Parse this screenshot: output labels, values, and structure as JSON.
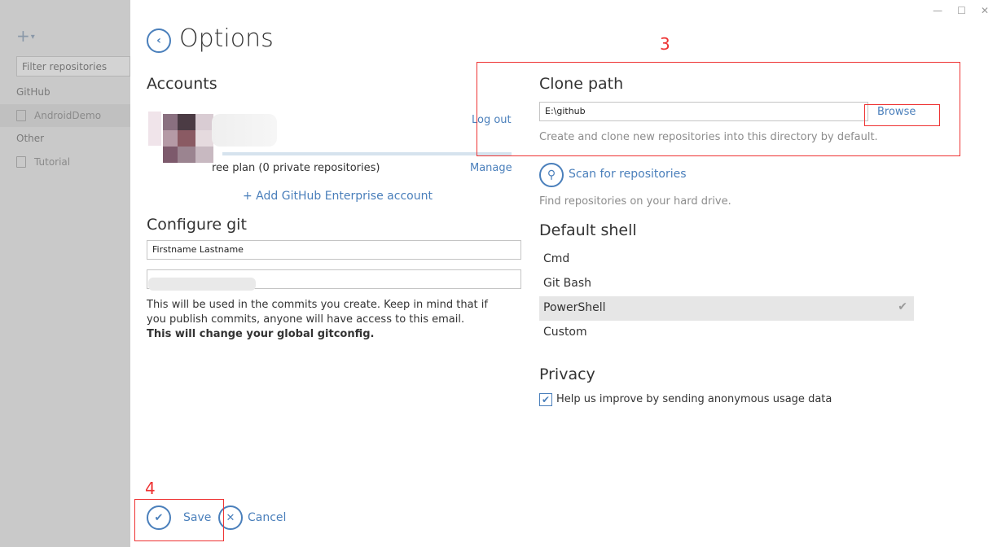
{
  "sidebar": {
    "add_label": "+",
    "filter_placeholder": "Filter repositories",
    "groups": [
      {
        "name": "GitHub",
        "repos": [
          "AndroidDemo"
        ]
      },
      {
        "name": "Other",
        "repos": [
          "Tutorial"
        ]
      }
    ]
  },
  "window": {
    "minimize": "—",
    "maximize": "☐",
    "close": "✕"
  },
  "header": {
    "title": "Options"
  },
  "accounts": {
    "heading": "Accounts",
    "logout": "Log out",
    "plan": "ree plan (0 private repositories)",
    "manage": "Manage",
    "add_enterprise": "+ Add GitHub Enterprise account"
  },
  "git": {
    "heading": "Configure git",
    "name_value": "Firstname Lastname",
    "email_value": "",
    "help_line1": "This will be used in the commits you create. Keep in mind that if you publish commits, anyone will have access to this email.",
    "help_line2": "This will change your global gitconfig."
  },
  "clone": {
    "heading": "Clone path",
    "path_value": "E:\\github",
    "browse": "Browse",
    "help": "Create and clone new repositories into this directory by default."
  },
  "scan": {
    "label": "Scan for repositories",
    "help": "Find repositories on your hard drive."
  },
  "shell": {
    "heading": "Default shell",
    "options": [
      "Cmd",
      "Git Bash",
      "PowerShell",
      "Custom"
    ],
    "selected": "PowerShell"
  },
  "privacy": {
    "heading": "Privacy",
    "checkbox_label": "Help us improve by sending anonymous usage data",
    "checked": true
  },
  "footer": {
    "save": "Save",
    "cancel": "Cancel"
  },
  "annotations": {
    "box3": "3",
    "box4": "4"
  },
  "colors": {
    "accent": "#4a7fbb",
    "annotation": "#e33333",
    "sidebar": "#c9c9c9"
  }
}
